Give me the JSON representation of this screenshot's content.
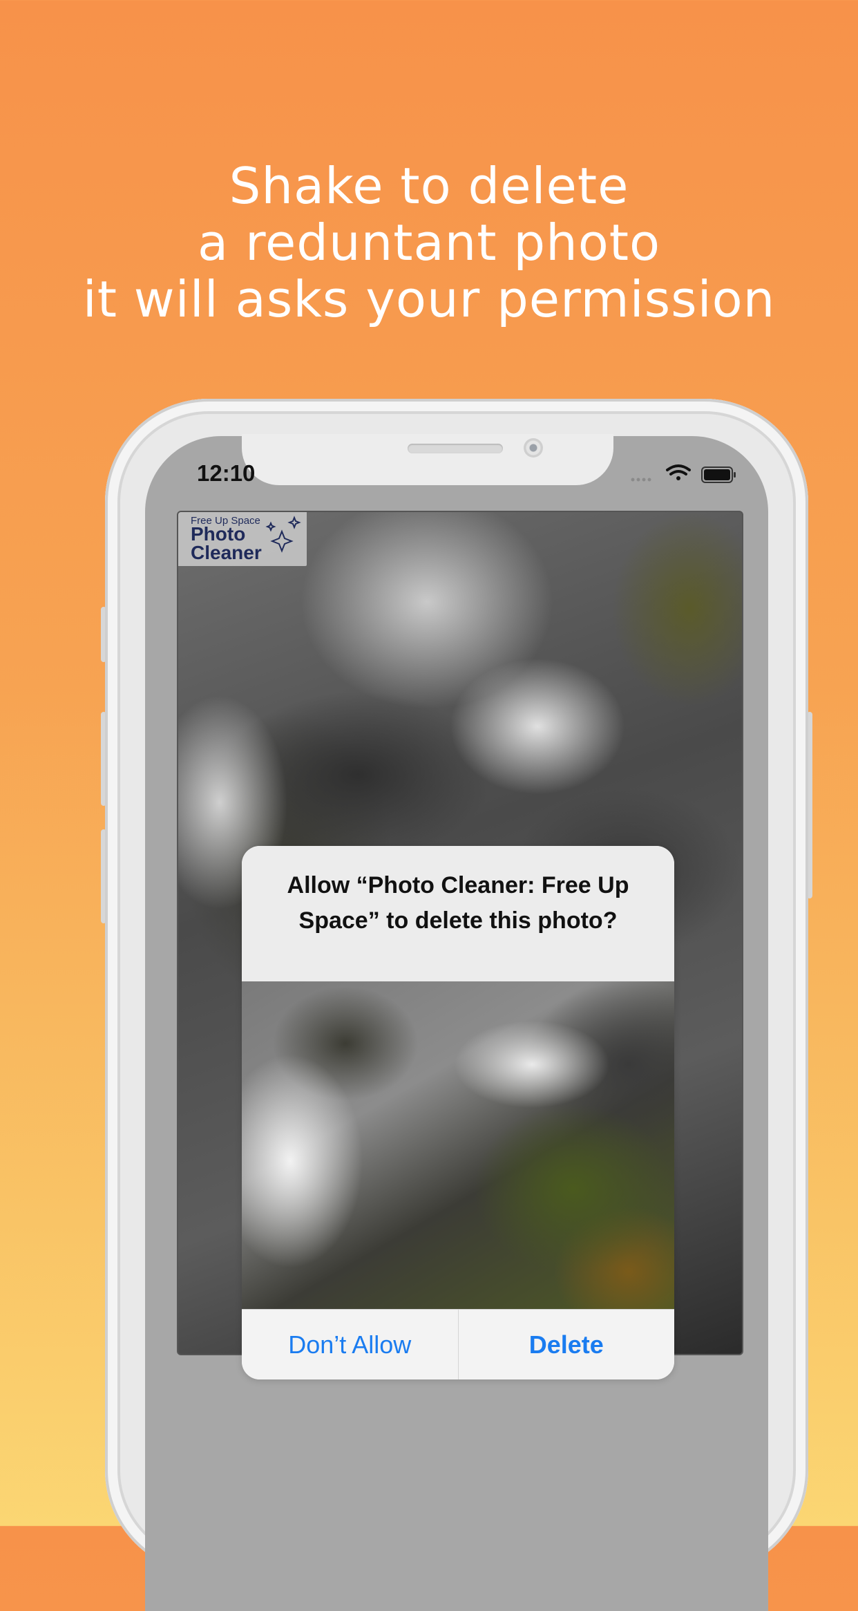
{
  "headline": {
    "line1": "Shake to delete",
    "line2": "a reduntant photo",
    "line3": "it will asks your permission"
  },
  "status_bar": {
    "time": "12:10",
    "icons": [
      "signal-dots-icon",
      "wifi-icon",
      "battery-icon"
    ]
  },
  "app_logo": {
    "tagline": "Free Up Space",
    "name_line1": "Photo",
    "name_line2": "Cleaner"
  },
  "alert": {
    "title": "Allow “Photo Cleaner: Free Up Space” to delete this photo?",
    "cancel_label": "Don’t Allow",
    "confirm_label": "Delete"
  },
  "colors": {
    "background_top": "#F7924A",
    "background_bottom": "#FBD673",
    "alert_button": "#1A7CF0",
    "logo_text": "#1F2A5A"
  }
}
